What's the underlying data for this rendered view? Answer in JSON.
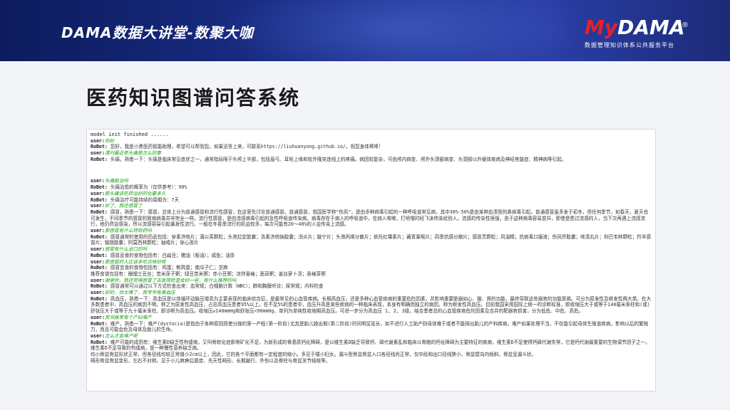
{
  "header": {
    "title": "DAMA数据大讲堂-数聚大咖",
    "logo": {
      "prefix": "My",
      "word": "DAMA",
      "reg": "®",
      "subtitle": "数据管理知识体系公共服务平台"
    }
  },
  "page_title": "医药知识图谱问答系统",
  "console": {
    "system_line": "model init finished ......",
    "lines": [
      {
        "role": "user",
        "prefix": "user:",
        "text": "你好"
      },
      {
        "role": "bot",
        "prefix": "RoBot:",
        "text": " 您好，我是小勇医药智能助理，希望可以帮到您。如果没答上来，可联系https://liuhuanyong.github.io/。祝您身体棒棒！"
      },
      {
        "role": "user",
        "prefix": "user:",
        "text": "请问最近老头痛是怎么回事"
      },
      {
        "role": "bot",
        "prefix": "RoBot:",
        "text": " 头痛，熟悉一下：头痛是临床常见症状之一，通常指局限于头颅上半部，包括眉弓、耳轮上缘和枕外隆突连线上的疼痛。病因较复杂，可由颅内病变、颅外头颈部病变、头颈部以外躯体疾病及神经官能症、精神病等引起。"
      },
      {
        "role": "blank"
      },
      {
        "role": "user",
        "prefix": "user:",
        "text": "头痛能治吗"
      },
      {
        "role": "bot",
        "prefix": "RoBot:",
        "text": " 头痛治愈的概率为（仅供参考）：90%"
      },
      {
        "role": "user",
        "prefix": "user:",
        "text": "那头痛该吃药治好的化要多久"
      },
      {
        "role": "bot",
        "prefix": "RoBot:",
        "text": " 头痛治疗可能持续的周期为：7天"
      },
      {
        "role": "user",
        "prefix": "user:",
        "text": "好了，我还感冒了"
      },
      {
        "role": "bot",
        "prefix": "RoBot:",
        "text": " 感冒，熟悉一下：感冒，总体上分为普通感冒和流行性感冒，在这里先讨论普通感冒。普通感冒，祖国医学称\"伤风\"，是由多种病毒引起的一种呼吸道常见病，其中30%-50%是由某种血清型的鼻病毒引起。普通感冒虽多发于初冬，但任何季节，如春天，夏天也可发生，不同季节的感冒的致病病毒并非完全一样。流行性感冒，是由流感病毒引起的急性呼吸道传染病。病毒存在于病人的呼吸道中，在病人咳嗽，打喷嚏时经飞沫传染给别人。流感的传染性很强，由于这种病毒容易变异，即使是患过流感的人，当下次再遇上流感流行，他仍然会感染，所以流感容易引起暴发性流行。一般在冬春季流行的机会较多，每次可能有20～40%的人会传染上流感。"
      },
      {
        "role": "user",
        "prefix": "user:",
        "text": "那感冒有什么特效药吗"
      },
      {
        "role": "bot",
        "prefix": "RoBot:",
        "text": " 感冒通常的使用的药品包括：穿素济络片；蒲公英颗粒；头孢拉定胶囊；洛素济络钠胶囊；消炎片；脑宁片；头孢丙烯分散片；依托红霉素片；藏青果喉片；四季抗感分散片；感冒灵颗粒；风油精；抗病毒口服液；伤风停胶囊；咳清丸片；利巴韦林颗粒；羚羊感冒片；银翘胶囊；阿莫西林颗粒；抽噎片；穿心莲片"
      },
      {
        "role": "user",
        "prefix": "user:",
        "text": "感冒有什么忌口的吗"
      },
      {
        "role": "bot",
        "prefix": "RoBot:",
        "text": " 感冒忌食的食物包括有：白扁豆；猪油（板油）；咸鱼；油条"
      },
      {
        "role": "user",
        "prefix": "user:",
        "text": "那感冒的人应该多吃点啥好呢"
      },
      {
        "role": "bot",
        "prefix": "RoBot:",
        "text": " 感冒宜食的食物包括有：鸡蛋；鹌鹑蛋；南瓜子仁；芝麻"
      },
      {
        "role": "bot",
        "prefix": "",
        "text": "推荐食谱包括有：醋熘土豆丝；苦米莲子粥；绿豆苦米粥；赤小豆粥；凉拌香椿；葱蒜粥；姜丝萝卜汤；香椿芽粥"
      },
      {
        "role": "user",
        "prefix": "user:",
        "text": "谢谢你，我还觉得感冒了去医院检查会好一些，有什么推荐的吗"
      },
      {
        "role": "bot",
        "prefix": "RoBot:",
        "text": " 感冒通常可以通过以下方式检查出来：血常规；白细胞计数（WBC）；肺和胸膜听诊；尿常规；内科检查"
      },
      {
        "role": "user",
        "prefix": "user:",
        "text": "好的，你太棒了，我爷爷有高血压"
      },
      {
        "role": "bot",
        "prefix": "RoBot:",
        "text": " 高血压，熟悉一下：高血压是以体循环动脉压增高为主要表现的临床综合征，是最常见的心血管疾病。长期高血压，还是多种心血管疾病的重要危险因素，并影响重要脏器如心、脑、肾的功能，最终导致这些器官的功能衰竭。可分为原发性及继发性两大类。在大多数患者中，高血压的病因不明，称之为原发性高血压，占总高血压患者95%以上。在不足5%的患者中，血压升高是某些疾病的一种临床表现，本身有明确而独立的病因，称为继发性高血压。目前我国采用国际上统一的诊断标准，即收缩压大于或等于140毫米汞柱和(或)舒张压大于或等于九十毫米汞柱，即诊断为高血压。收缩压≥140mmHg和舒张压<90mmHg，单列为单纯性收缩期高血压。可进一步分为高血压 1, 2, 3级，结合患者总的心血管疾病危险因素及合并的靶器官损害，分为低危、中危、高危。"
      },
      {
        "role": "user",
        "prefix": "user:",
        "text": "我邻居家有个产妇难产"
      },
      {
        "role": "bot",
        "prefix": "RoBot:",
        "text": " 难产，熟悉一下：难产(dystocia)是指由于各种原因而使分娩的第一产程(第一阶段)尤其是胎儿娩出期(第二阶段)时间明显延长，如不进行人工助产则母体难于或者不能排出胎儿的产科疾病。难产如果处理不当，不仅能引起母体生殖道疾病，影响以后的繁殖力，而且可能会危及母体及胎儿的生命。"
      },
      {
        "role": "user",
        "prefix": "user:",
        "text": "怎么才会难产呢"
      },
      {
        "role": "bot",
        "prefix": "RoBot:",
        "text": " 难产可能的成因有：维生素D缺乏性佝偻病，又叫骨软化症即骨矿化不足，为新形成的骨基质钙化障碍，是以维生素D缺乏导致钙、磷代谢紊乱和临床以骨骼的钙化障碍为主要特征的疾病，维生素D不足使得钙磷代谢失常，它是钙代谢最重要的生物调节因子之一。维生素D不足导致的佝偻病，是一种慢性营养缺乏病。"
      },
      {
        "role": "bot",
        "prefix": "",
        "text": "均小骨盆骨盆形状正常，但各径线均较正常值小2cm以上，因此，它的各个平面都有一定程度的缩小。多见于矮小妇女。漏斗型骨盆骨盆入口各径线尚正常，仅中段和出口径线狭小，骨盆壁向内倾斜，骨盆呈漏斗状。"
      },
      {
        "role": "bot",
        "prefix": "",
        "text": "畸形骨盆骨盆变形，左右不对称。见于小儿麻痹后遗症、先天性畸形、长期跛行、外伤以及脊柱与骨盆关节结核等。"
      }
    ]
  }
}
